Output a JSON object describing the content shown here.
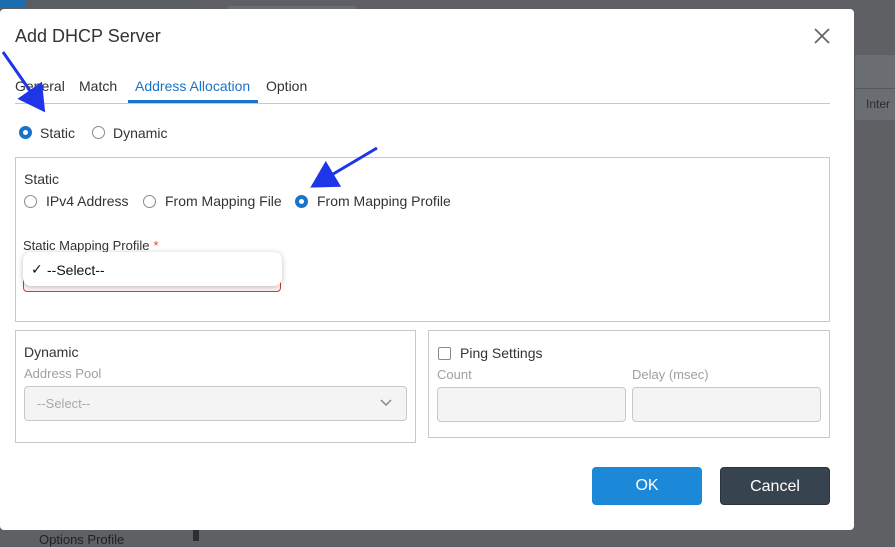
{
  "background": {
    "right_partial_text": "Inter",
    "bottom_partial_text": "Options Profile"
  },
  "dialog": {
    "title": "Add DHCP Server",
    "close_icon": "close-icon"
  },
  "tabs": [
    {
      "label": "General",
      "active": false
    },
    {
      "label": "Match",
      "active": false
    },
    {
      "label": "Address Allocation",
      "active": true
    },
    {
      "label": "Option",
      "active": false
    }
  ],
  "allocation_mode": {
    "options": [
      {
        "label": "Static",
        "checked": true
      },
      {
        "label": "Dynamic",
        "checked": false
      }
    ]
  },
  "static_section": {
    "title": "Static",
    "options": [
      {
        "label": "IPv4 Address",
        "checked": false
      },
      {
        "label": "From Mapping File",
        "checked": false
      },
      {
        "label": "From Mapping Profile",
        "checked": true
      }
    ],
    "profile_label": "Static Mapping Profile",
    "required_mark": "*",
    "dropdown": {
      "check": "✓",
      "selected": "--Select--"
    }
  },
  "dynamic_section": {
    "title": "Dynamic",
    "pool_label": "Address Pool",
    "pool_value": "--Select--"
  },
  "ping_section": {
    "checkbox_label": "Ping Settings",
    "count_label": "Count",
    "delay_label": "Delay (msec)",
    "count_value": "",
    "delay_value": ""
  },
  "buttons": {
    "ok": "OK",
    "cancel": "Cancel"
  },
  "colors": {
    "accent": "#1a73c8",
    "ok_button": "#1b88d8",
    "cancel_button": "#384350",
    "error": "#cf3b37",
    "annotation_arrow": "#1f35e8"
  }
}
